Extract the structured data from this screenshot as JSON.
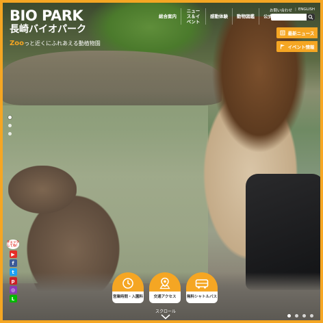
{
  "logo": {
    "en": "BIO PARK",
    "jp": "長崎バイオパーク"
  },
  "tagline": {
    "zoo": "Zoo",
    "rest": "っと近くにふれあえる動植物園"
  },
  "nav": [
    {
      "label": "総合案内"
    },
    {
      "label": "ニュース＆イベント"
    },
    {
      "label": "感動体験"
    },
    {
      "label": "動物図鑑"
    },
    {
      "label": "公式ブログ"
    }
  ],
  "utility": {
    "contact": "お問い合わせ",
    "english": "ENGLISH"
  },
  "side_tabs": {
    "news": "最新ニュース",
    "events": "イベント情報"
  },
  "social": {
    "check_label": "チェックしてね！",
    "icons": [
      "youtube-icon",
      "facebook-icon",
      "twitter-icon",
      "pinterest-icon",
      "instagram-icon",
      "line-icon"
    ]
  },
  "quick_links": [
    {
      "label": "営業時間・入園料",
      "icon": "clock-icon"
    },
    {
      "label": "交通アクセス",
      "icon": "map-pin-icon"
    },
    {
      "label": "無料シャトルバス",
      "icon": "bus-icon"
    }
  ],
  "scroll": {
    "label": "スクロール"
  },
  "colors": {
    "accent": "#f5a623"
  },
  "slider": {
    "active_index": 0,
    "count_bottom": 4,
    "count_left": 3
  }
}
